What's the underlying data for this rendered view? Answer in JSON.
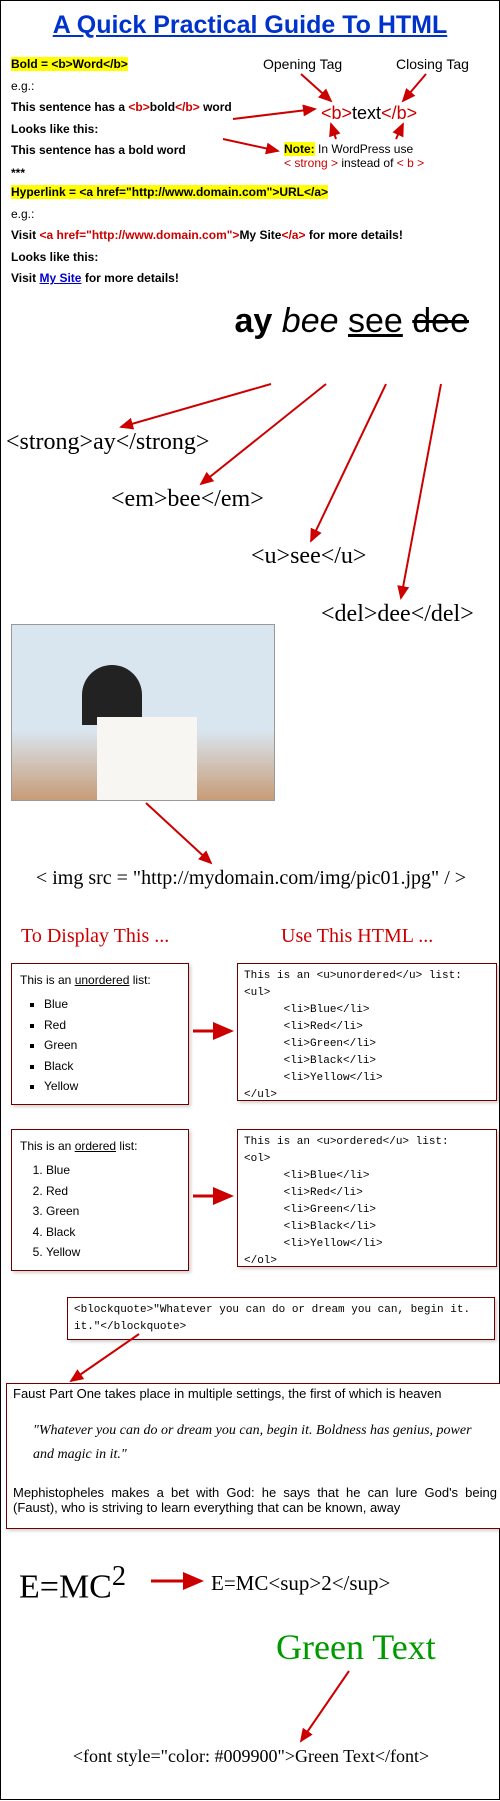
{
  "title": "A Quick Practical Guide To HTML",
  "bold": {
    "def": "Bold = <b>Word</b>",
    "eg": "e.g.:",
    "src_a": "This sentence has a ",
    "src_b": "<b>",
    "src_c": "bold",
    "src_d": "</b>",
    "src_e": " word",
    "looks": "Looks like this:",
    "out_a": "This sentence has a ",
    "out_b": "bold",
    "out_c": " word"
  },
  "tags": {
    "opening": "Opening Tag",
    "closing": "Closing Tag",
    "open": "<b>",
    "text": "text",
    "close": "</b>"
  },
  "note": {
    "label": "Note:",
    "a": " In WordPress use ",
    "strong": "< strong >",
    "b": " instead of ",
    "bold": "< b >"
  },
  "stars": "***",
  "hyper": {
    "def": "Hyperlink = <a href=\"http://www.domain.com\">URL</a>",
    "eg": "e.g.:",
    "src_a": "Visit ",
    "src_b": "<a href=\"http://www.domain.com\">",
    "src_c": "My Site",
    "src_d": "</a>",
    "src_e": " for more details!",
    "looks": "Looks like this:",
    "out_a": "Visit ",
    "out_b": "My Site",
    "out_c": " for more details!"
  },
  "demo": {
    "ay": "ay",
    "bee": "bee",
    "see": "see",
    "dee": "dee",
    "strong_tag": "<strong>ay</strong>",
    "em_tag": "<em>bee</em>",
    "u_tag": "<u>see</u>",
    "del_tag": "<del>dee</del>"
  },
  "img_code": "< img src = \"http://mydomain.com/img/pic01.jpg\" / >",
  "cols": {
    "left": "To Display This ...",
    "right": "Use This HTML ..."
  },
  "ul_box": {
    "title_a": "This is an ",
    "title_b": "unordered",
    "title_c": " list:",
    "items": [
      "Blue",
      "Red",
      "Green",
      "Black",
      "Yellow"
    ]
  },
  "ul_code": "This is an <u>unordered</u> list:\n<ul>\n      <li>Blue</li>\n      <li>Red</li>\n      <li>Green</li>\n      <li>Black</li>\n      <li>Yellow</li>\n</ul>",
  "ol_box": {
    "title_a": "This is an ",
    "title_b": "ordered",
    "title_c": " list:",
    "items": [
      "Blue",
      "Red",
      "Green",
      "Black",
      "Yellow"
    ]
  },
  "ol_code": "This is an <u>ordered</u> list:\n<ol>\n      <li>Blue</li>\n      <li>Red</li>\n      <li>Green</li>\n      <li>Black</li>\n      <li>Yellow</li>\n</ol>",
  "bq_code": "<blockquote>\"Whatever you can do or dream you can, begin it. it.\"</blockquote>",
  "faust": {
    "before": "Faust Part One takes place in multiple settings, the first of which is heaven",
    "quote": "\"Whatever you can do or dream you can, begin it. Boldness has genius, power and magic in it.\"",
    "after": "Mephistopheles makes a bet with God: he says that he can lure God's being (Faust), who is striving to learn everything that can be known, away"
  },
  "emc": {
    "display": "E=MC",
    "sup": "2",
    "code": "E=MC<sup>2</sup>"
  },
  "green": {
    "text": "Green Text",
    "code": "<font style=\"color: #009900\">Green Text</font>"
  }
}
